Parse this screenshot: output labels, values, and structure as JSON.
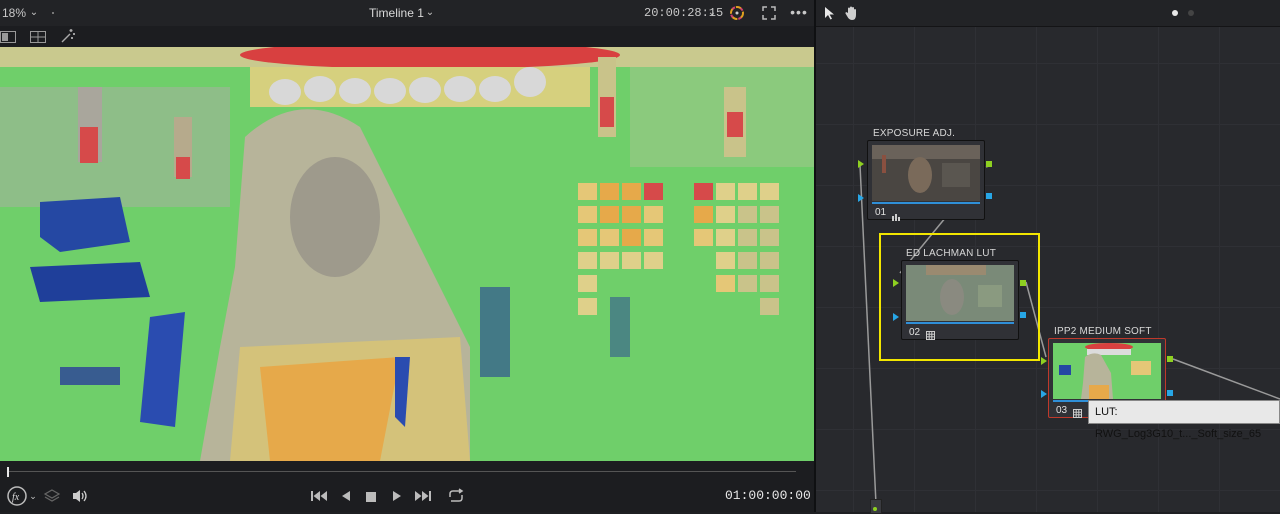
{
  "viewer": {
    "zoom": "18%",
    "timeline_title": "Timeline 1",
    "timecode_top": "20:00:28:15",
    "timecode_bottom": "01:00:00:00"
  },
  "nodes": [
    {
      "label": "EXPOSURE ADJ.",
      "number": "01"
    },
    {
      "label": "ED LACHMAN LUT",
      "number": "02"
    },
    {
      "label": "IPP2  MEDIUM SOFT",
      "number": "03"
    }
  ],
  "tooltip": {
    "text": "LUT: RWG_Log3G10_t..._Soft_size_65"
  },
  "colors": {
    "selection": "#f2e600",
    "node_red_outline": "#c0392b",
    "port_green": "#8ed021",
    "port_blue": "#27a6e6"
  },
  "icons": [
    "chevron-down-icon",
    "color-wheel-icon",
    "fullscreen-icon",
    "more-icon",
    "pointer-icon",
    "hand-icon",
    "single-view-icon",
    "split-view-icon",
    "magic-wand-icon",
    "fx-icon",
    "layers-icon",
    "speaker-icon",
    "skip-start-icon",
    "step-back-icon",
    "stop-icon",
    "play-icon",
    "skip-end-icon",
    "loop-icon"
  ]
}
